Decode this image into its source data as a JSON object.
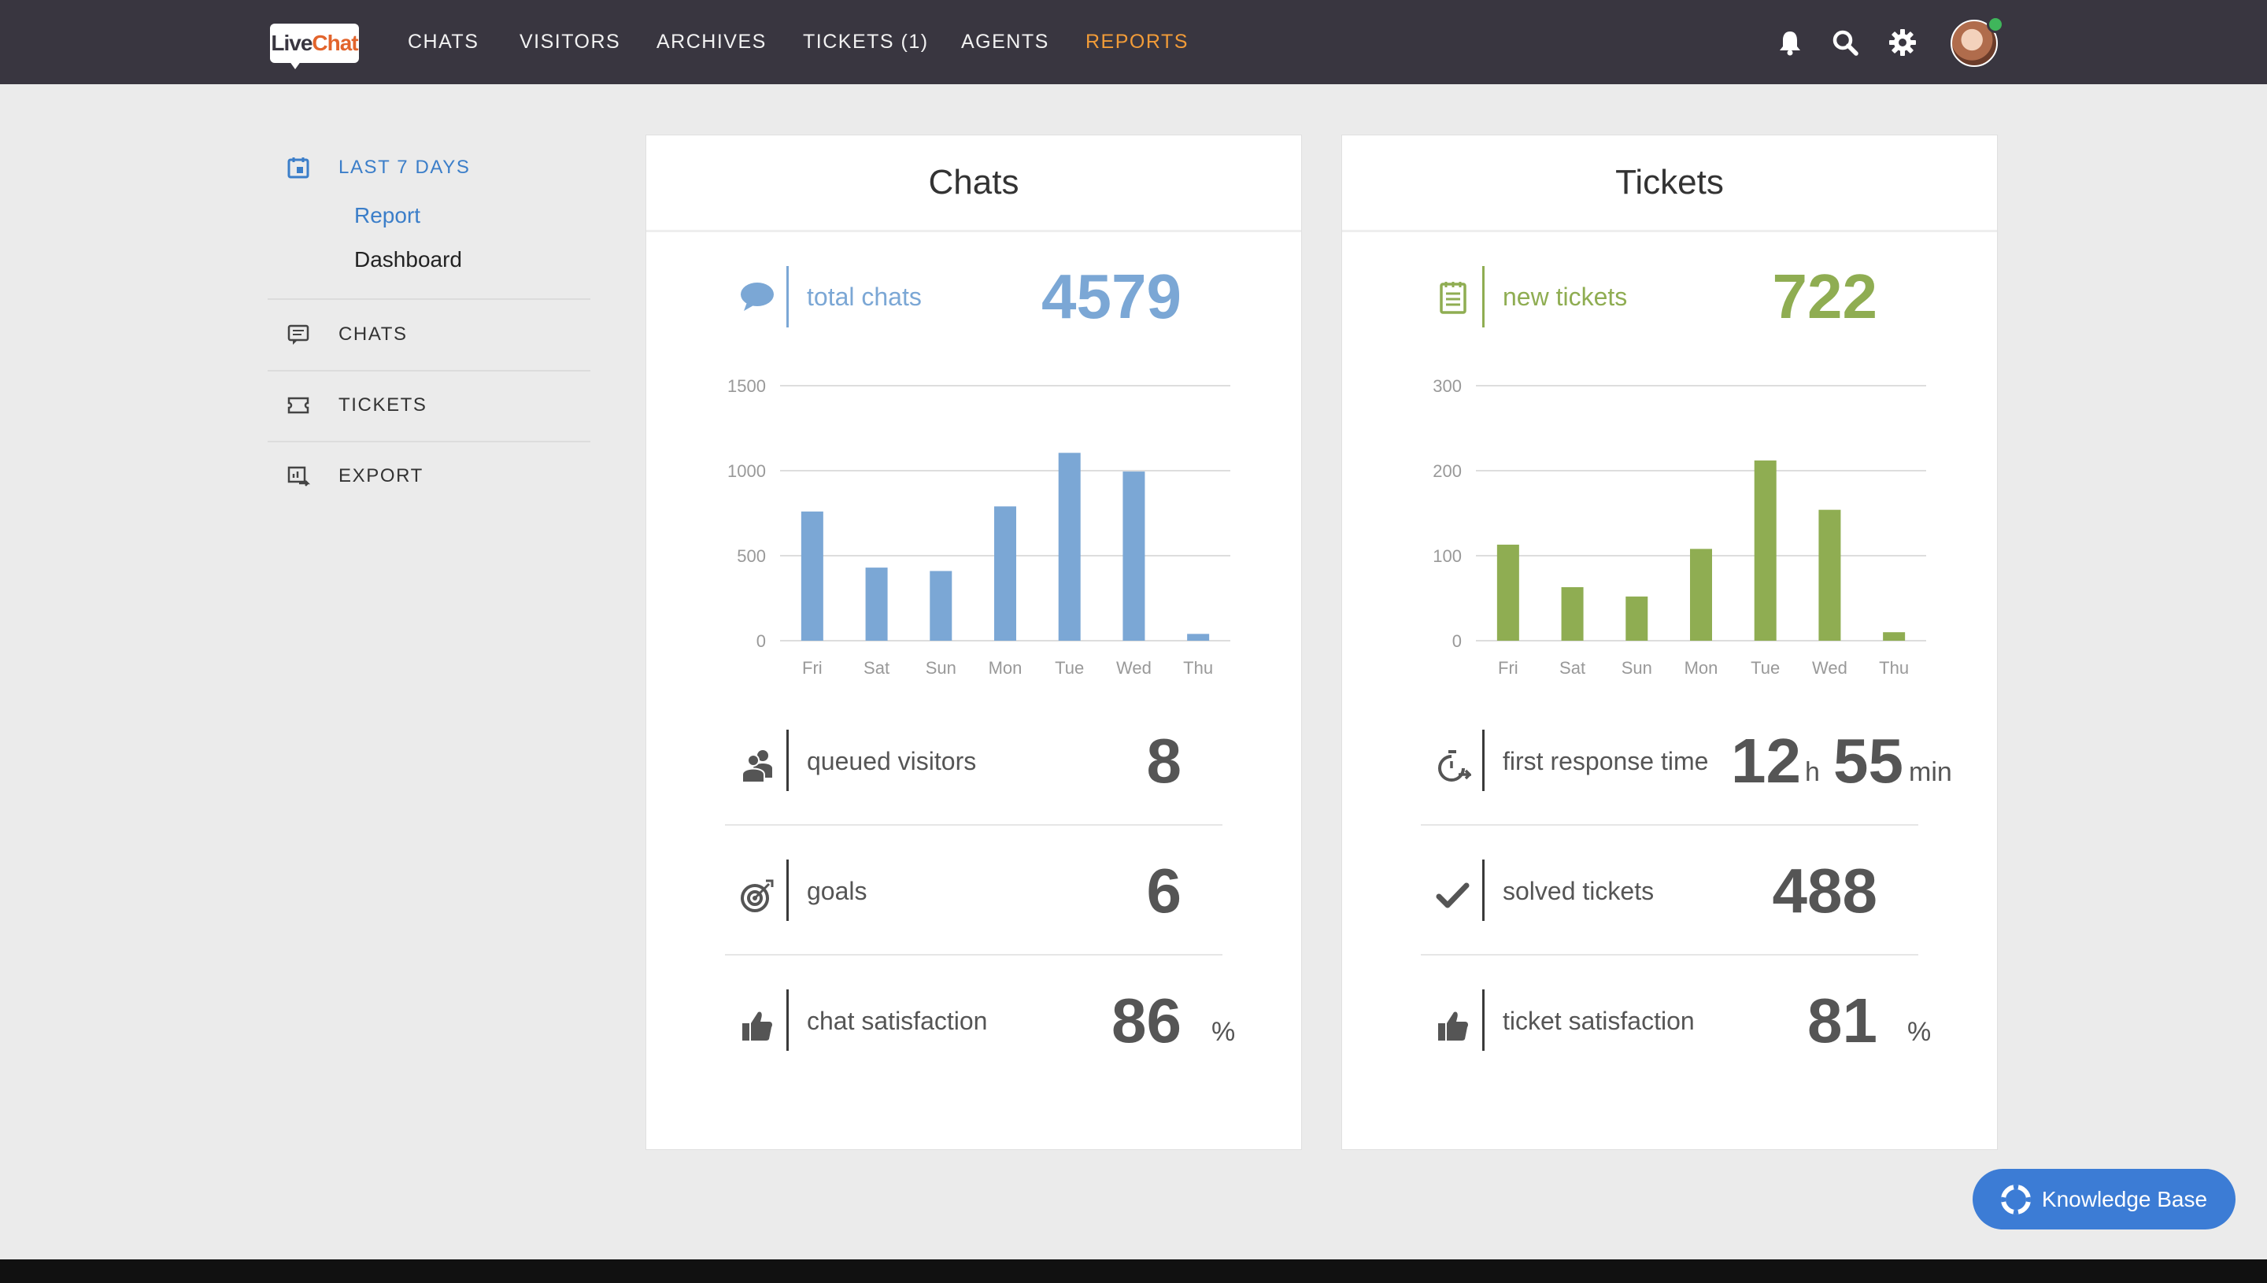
{
  "app": {
    "logo": {
      "live": "Live",
      "chat": "Chat"
    }
  },
  "nav": {
    "items": [
      {
        "label": "CHATS"
      },
      {
        "label": "VISITORS"
      },
      {
        "label": "ARCHIVES"
      },
      {
        "label": "TICKETS (1)"
      },
      {
        "label": "AGENTS"
      },
      {
        "label": "REPORTS",
        "active": true
      }
    ],
    "icons": [
      "bell-icon",
      "search-icon",
      "gear-icon",
      "avatar"
    ]
  },
  "sidebar": {
    "range_label": "LAST 7 DAYS",
    "sub_items": [
      {
        "label": "Report",
        "active": true
      },
      {
        "label": "Dashboard"
      }
    ],
    "items": [
      {
        "label": "CHATS",
        "icon": "chat-icon"
      },
      {
        "label": "TICKETS",
        "icon": "ticket-icon"
      },
      {
        "label": "EXPORT",
        "icon": "export-icon"
      }
    ]
  },
  "colors": {
    "accent_blue": "#7ba7d5",
    "accent_green": "#8fad52",
    "nav_active": "#f29c38",
    "topbar": "#393640"
  },
  "chats_card": {
    "title": "Chats",
    "total_label": "total chats",
    "total_value": "4579",
    "metrics": [
      {
        "icon": "queue-icon",
        "label": "queued visitors",
        "value": "8",
        "unit": ""
      },
      {
        "icon": "target-icon",
        "label": "goals",
        "value": "6",
        "unit": ""
      },
      {
        "icon": "thumbs-up-icon",
        "label": "chat satisfaction",
        "value": "86",
        "unit": "%"
      }
    ]
  },
  "tickets_card": {
    "title": "Tickets",
    "total_label": "new tickets",
    "total_value": "722",
    "first_response": {
      "label": "first response time",
      "hours": "12",
      "h_unit": "h",
      "minutes": "55",
      "m_unit": "min"
    },
    "metrics": [
      {
        "icon": "check-icon",
        "label": "solved tickets",
        "value": "488",
        "unit": ""
      },
      {
        "icon": "thumbs-up-icon",
        "label": "ticket satisfaction",
        "value": "81",
        "unit": "%"
      }
    ]
  },
  "chart_data": [
    {
      "type": "bar",
      "categories": [
        "Fri",
        "Sat",
        "Sun",
        "Mon",
        "Tue",
        "Wed",
        "Thu"
      ],
      "values": [
        760,
        430,
        410,
        790,
        1105,
        995,
        40
      ],
      "yticks": [
        0,
        500,
        1000,
        1500
      ],
      "ylim": [
        0,
        1500
      ],
      "grid": true,
      "color": "#7ba7d5"
    },
    {
      "type": "bar",
      "categories": [
        "Fri",
        "Sat",
        "Sun",
        "Mon",
        "Tue",
        "Wed",
        "Thu"
      ],
      "values": [
        113,
        63,
        52,
        108,
        212,
        154,
        10
      ],
      "yticks": [
        0,
        100,
        200,
        300
      ],
      "ylim": [
        0,
        300
      ],
      "grid": true,
      "color": "#8fad52"
    }
  ],
  "help": {
    "knowledge_base": "Knowledge Base"
  }
}
